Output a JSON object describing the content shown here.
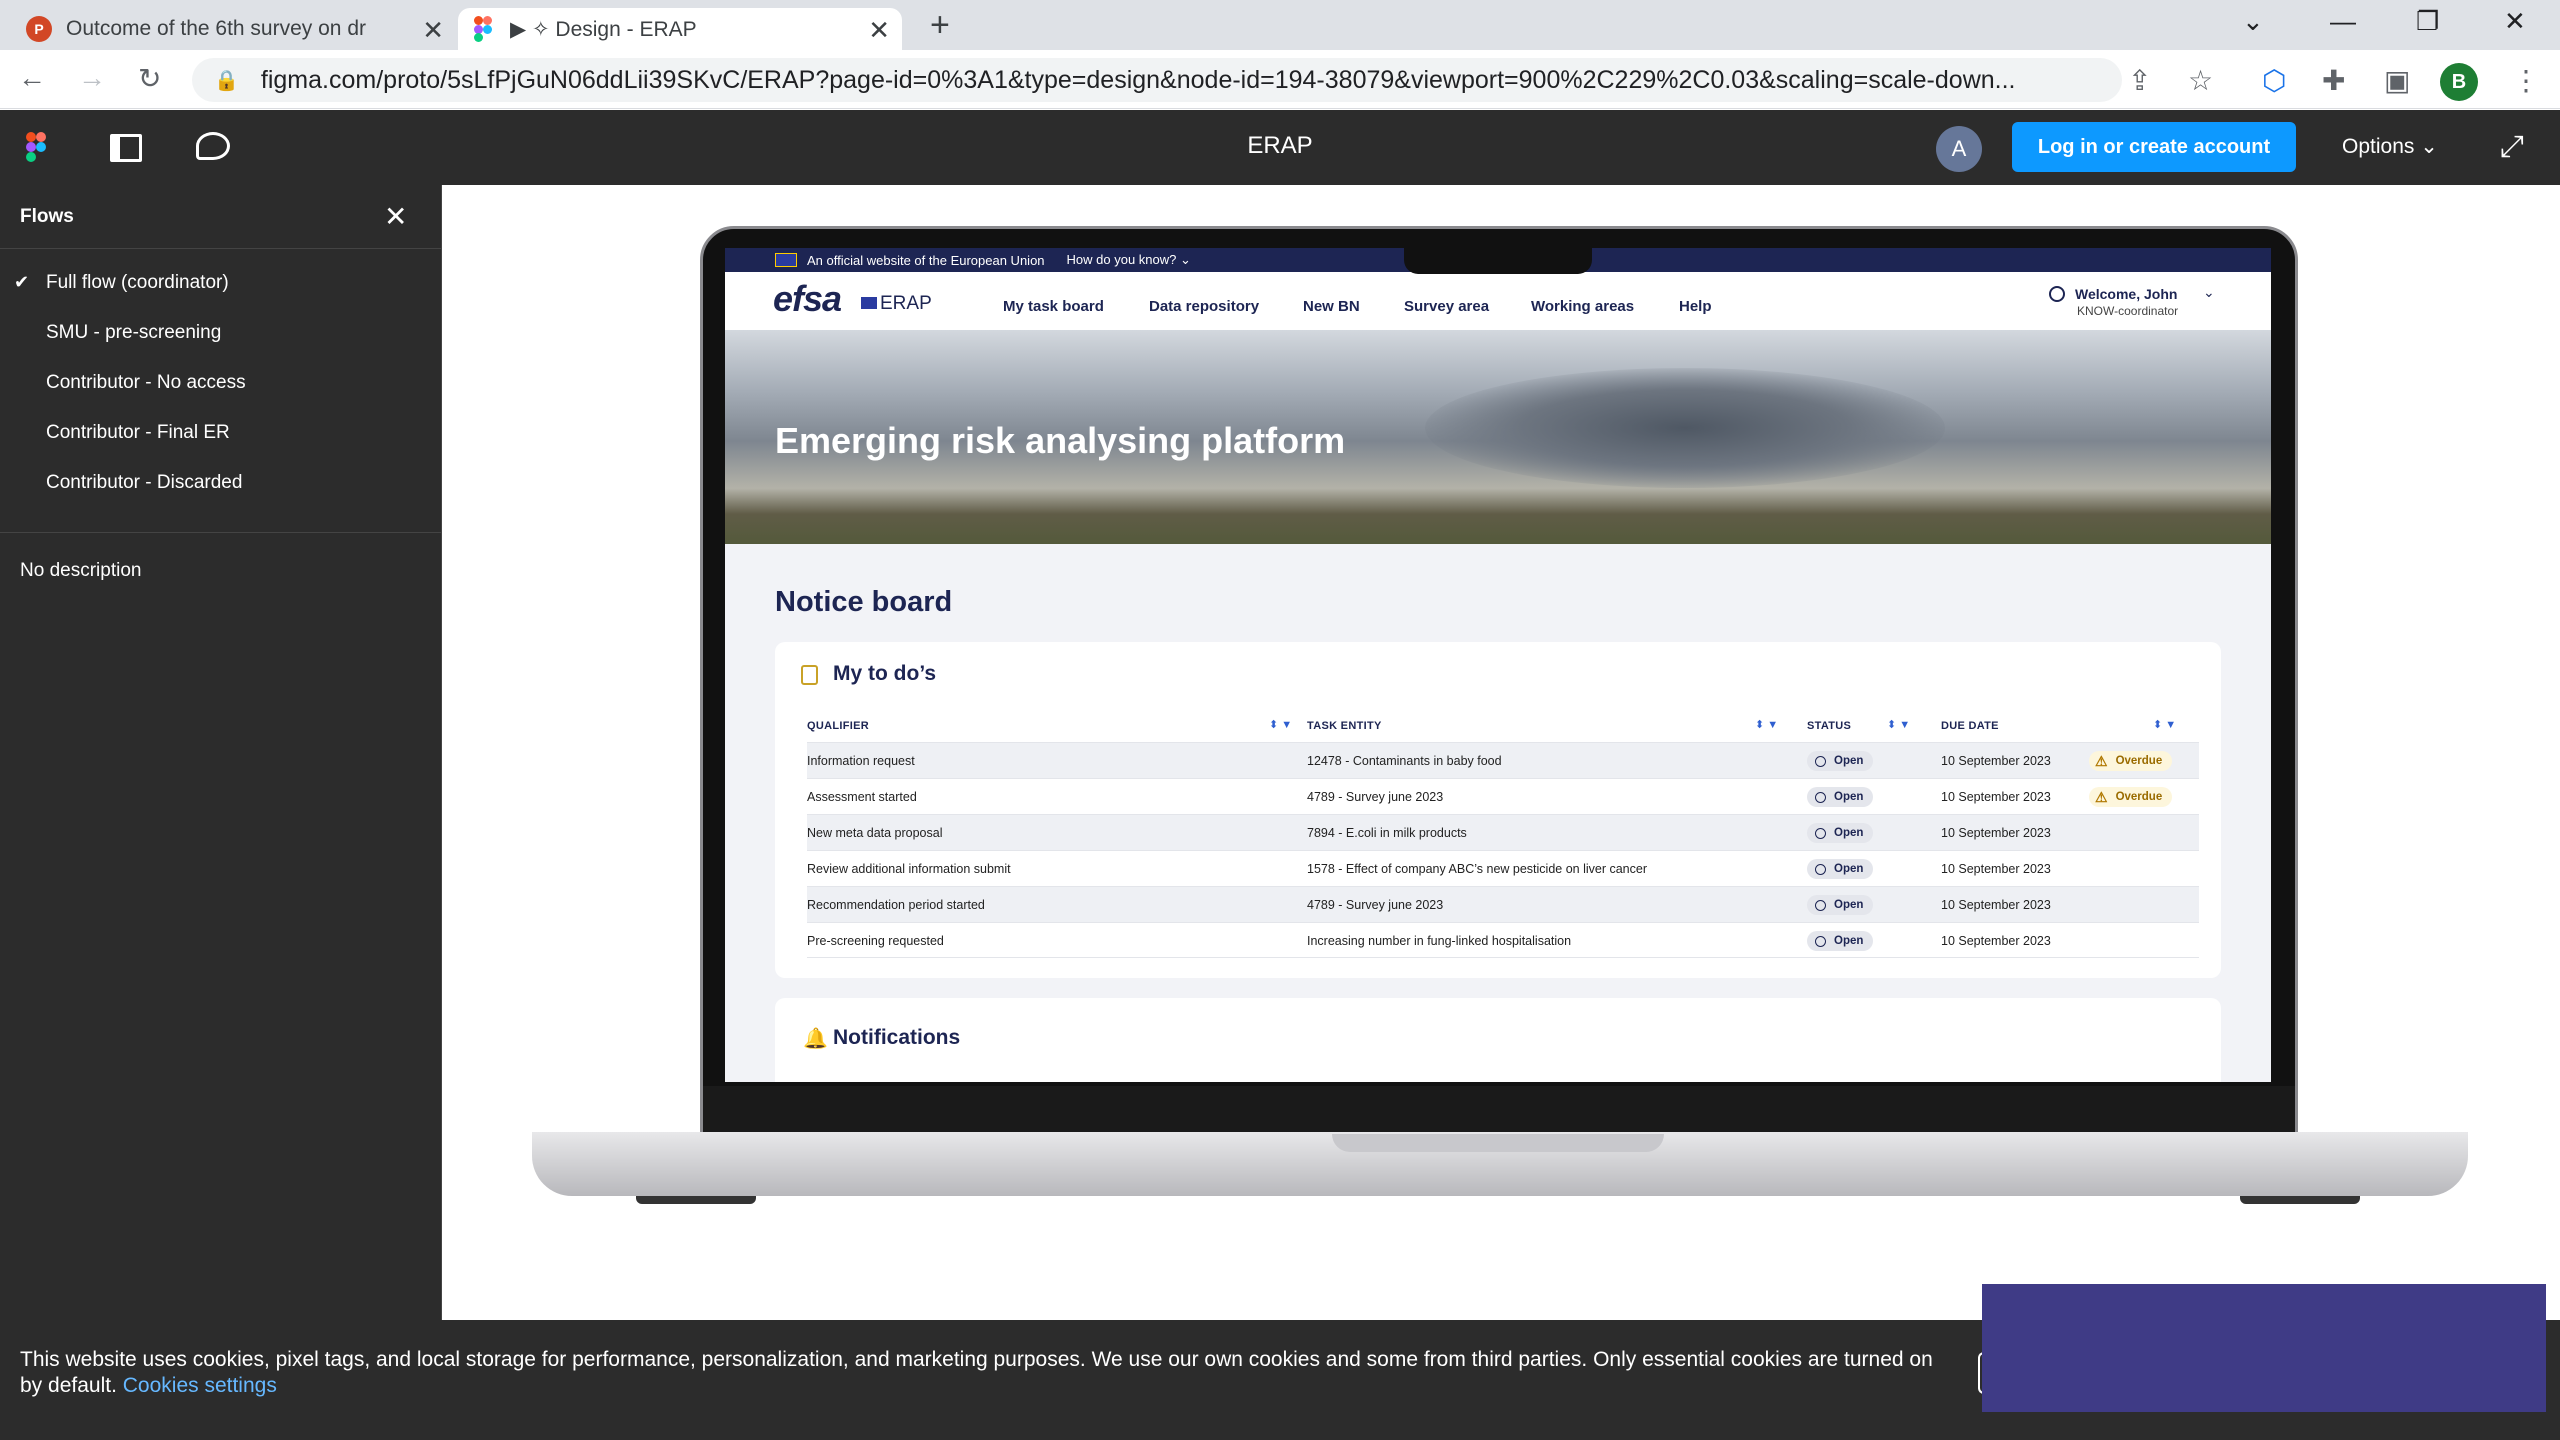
{
  "browser": {
    "tabs": [
      {
        "title": "Outcome of the 6th survey on dr",
        "icon": "powerpoint-icon",
        "icon_text": "P"
      },
      {
        "title": "▶ ✧ Design - ERAP",
        "icon": "figma-icon"
      }
    ],
    "new_tab": "+",
    "url": "figma.com/proto/5sLfPjGuN06ddLii39SKvC/ERAP?page-id=0%3A1&type=design&node-id=194-38079&viewport=900%2C229%2C0.03&scaling=scale-down...",
    "profile_initial": "B",
    "controls": {
      "minimize": "—",
      "restore": "❐",
      "close": "✕",
      "tablist": "⌄"
    }
  },
  "figma": {
    "file_title": "ERAP",
    "avatar_initial": "A",
    "login_button": "Log in or create account",
    "options_label": "Options ⌄",
    "accent": "#0d99ff"
  },
  "flows": {
    "header": "Flows",
    "items": [
      {
        "label": "Full flow (coordinator)",
        "selected": true
      },
      {
        "label": "SMU - pre-screening"
      },
      {
        "label": "Contributor - No access"
      },
      {
        "label": "Contributor - Final ER"
      },
      {
        "label": "Contributor - Discarded"
      }
    ],
    "description": "No description"
  },
  "erap": {
    "eu_banner": "An official website of the European Union",
    "eu_how": "How do you know? ⌄",
    "logo": "efsa",
    "logo_suffix": "ERAP",
    "nav": [
      "My task board",
      "Data repository",
      "New BN",
      "Survey area",
      "Working areas",
      "Help"
    ],
    "welcome": "Welcome, John",
    "role": "KNOW-coordinator",
    "hero_title": "Emerging risk analysing platform",
    "notice_board": "Notice board",
    "todo": {
      "title": "My to do’s",
      "columns": [
        "QUALIFIER",
        "TASK ENTITY",
        "STATUS",
        "DUE DATE"
      ],
      "rows": [
        {
          "qualifier": "Information request",
          "entity": "12478 - Contaminants in baby food",
          "status": "Open",
          "due": "10 September 2023",
          "flag": "Overdue"
        },
        {
          "qualifier": "Assessment started",
          "entity": "4789 - Survey june 2023",
          "status": "Open",
          "due": "10 September 2023",
          "flag": "Overdue"
        },
        {
          "qualifier": "New meta data proposal",
          "entity": "7894 - E.coli in milk products",
          "status": "Open",
          "due": "10 September 2023",
          "flag": ""
        },
        {
          "qualifier": "Review additional information submit",
          "entity": "1578 - Effect of company ABC’s new pesticide on liver cancer",
          "status": "Open",
          "due": "10 September 2023",
          "flag": ""
        },
        {
          "qualifier": "Recommendation period started",
          "entity": "4789 - Survey june 2023",
          "status": "Open",
          "due": "10 September 2023",
          "flag": ""
        },
        {
          "qualifier": "Pre-screening requested",
          "entity": "Increasing number in fung-linked hospitalisation",
          "status": "Open",
          "due": "10 September 2023",
          "flag": ""
        }
      ]
    },
    "notifications": "Notifications"
  },
  "cookie": {
    "text": "This website uses cookies, pixel tags, and local storage for performance, personalization, and marketing purposes. We use our own cookies and some from third parties. Only essential cookies are turned on by default.",
    "link": "Cookies settings"
  }
}
